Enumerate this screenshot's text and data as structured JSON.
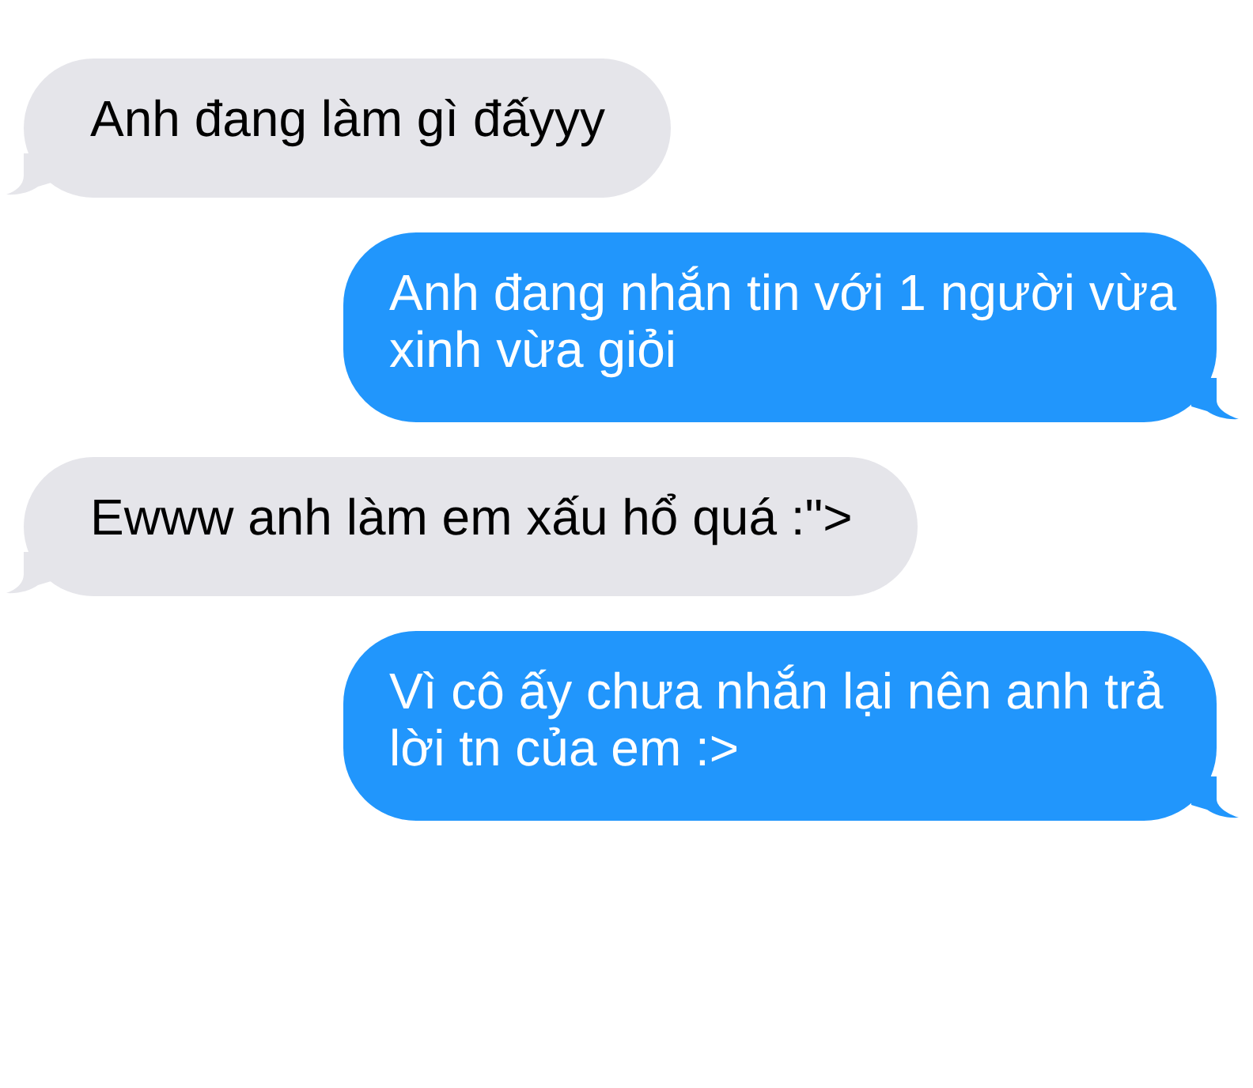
{
  "messages": [
    {
      "kind": "received",
      "text": "Anh đang làm gì đấyyy"
    },
    {
      "kind": "sent",
      "text": "Anh đang nhắn tin với 1 người vừa xinh vừa giỏi"
    },
    {
      "kind": "received",
      "text": "Ewww anh làm em xấu hổ quá :\">"
    },
    {
      "kind": "sent",
      "text": "Vì cô ấy chưa nhắn lại nên anh trả lời tn của em :>"
    }
  ]
}
